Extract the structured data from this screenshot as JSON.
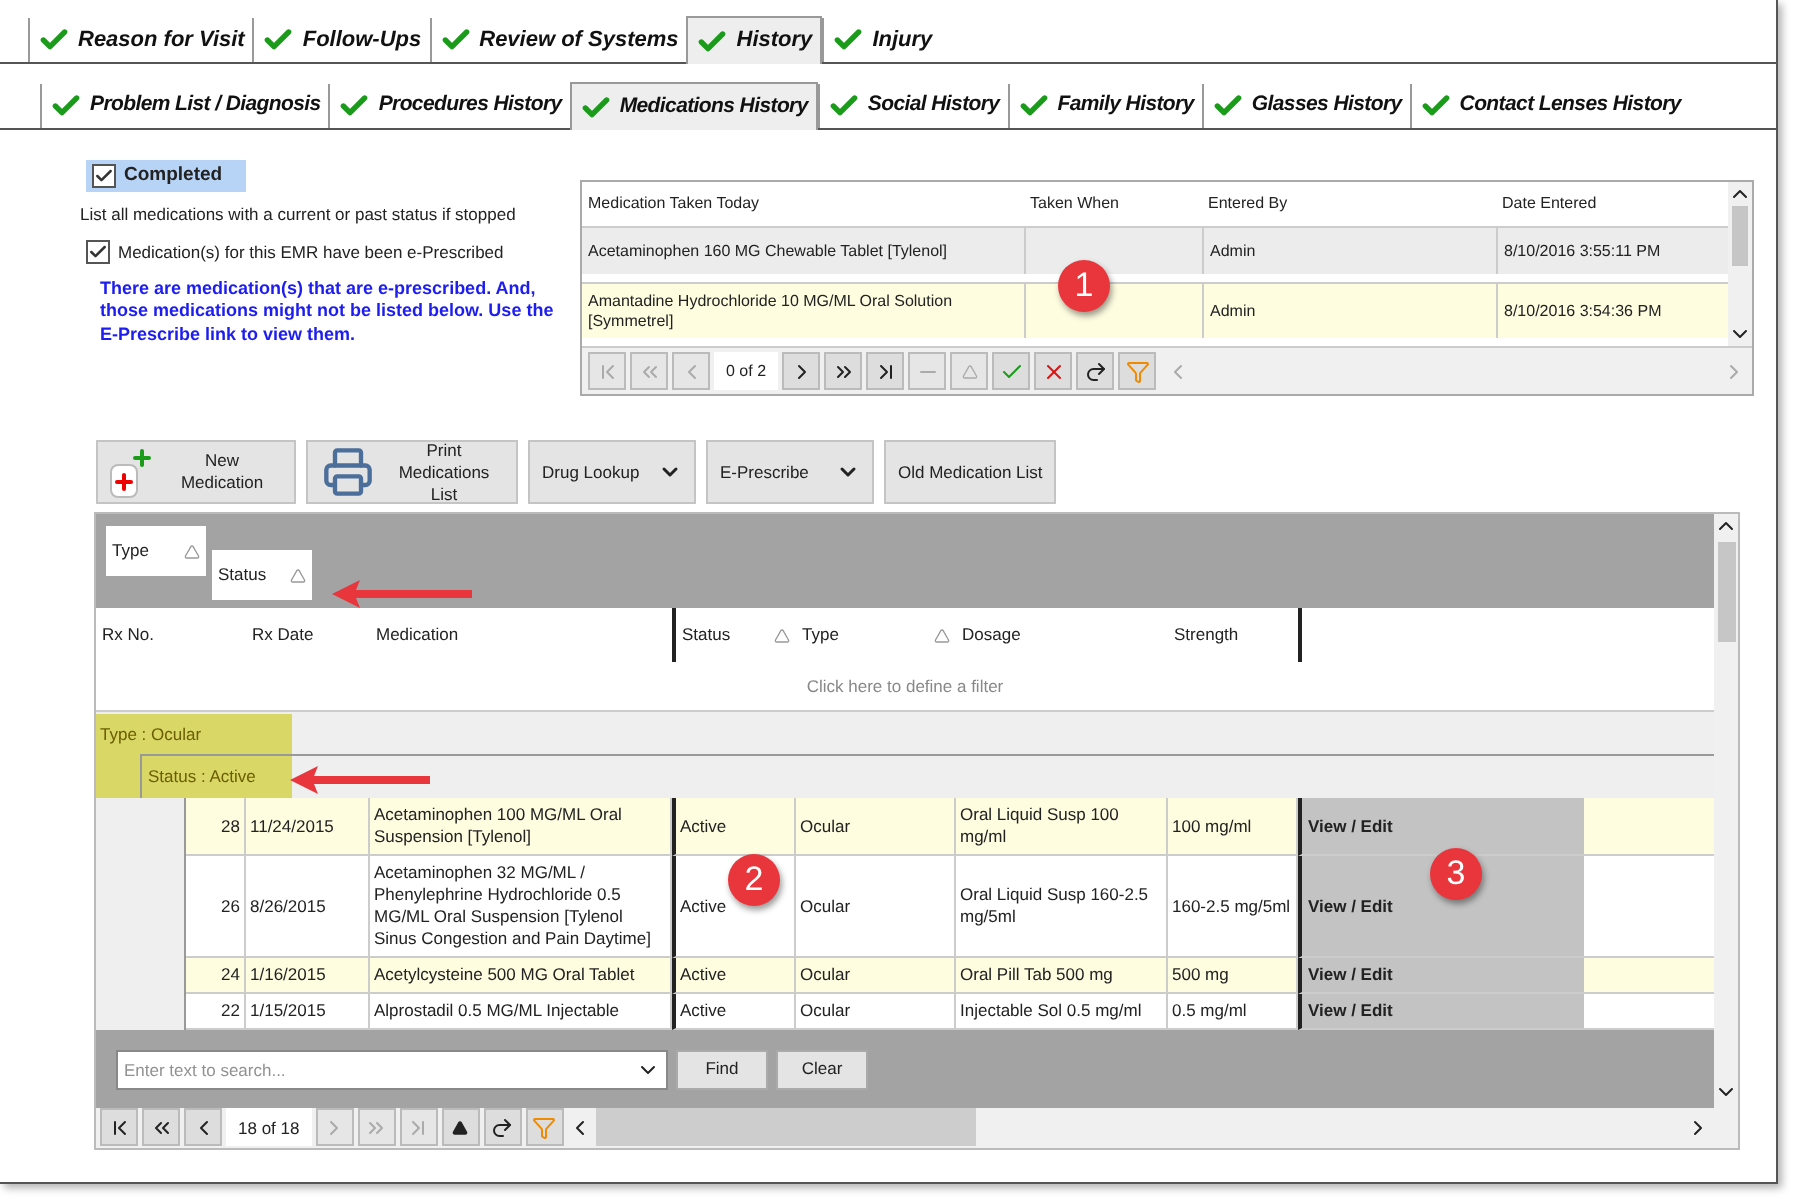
{
  "main_tabs": [
    {
      "label": "Reason for Visit",
      "selected": false
    },
    {
      "label": "Follow-Ups",
      "selected": false
    },
    {
      "label": "Review of Systems",
      "selected": false
    },
    {
      "label": "History",
      "selected": true
    },
    {
      "label": "Injury",
      "selected": false
    }
  ],
  "sub_tabs": [
    {
      "label": "Problem List / Diagnosis",
      "selected": false
    },
    {
      "label": "Procedures History",
      "selected": false
    },
    {
      "label": "Medications History",
      "selected": true
    },
    {
      "label": "Social History",
      "selected": false
    },
    {
      "label": "Family History",
      "selected": false
    },
    {
      "label": "Glasses History",
      "selected": false
    },
    {
      "label": "Contact Lenses History",
      "selected": false
    }
  ],
  "completed": {
    "label": "Completed",
    "checked": true
  },
  "note": "List all medications with a current or past status if stopped",
  "eprescribed": {
    "label": "Medication(s) for this EMR have been e-Prescribed",
    "checked": true
  },
  "warning": "There are medication(s) that are e-prescribed. And, those medications might not be listed below.  Use the E-Prescribe link to view them.",
  "today_grid": {
    "columns": [
      "Medication Taken Today",
      "Taken When",
      "Entered By",
      "Date Entered"
    ],
    "rows": [
      {
        "medication": "Acetaminophen 160 MG Chewable Tablet [Tylenol]",
        "entered_by": "Admin",
        "date_entered": "8/10/2016 3:55:11 PM",
        "selected": false
      },
      {
        "medication": "Amantadine Hydrochloride 10 MG/ML Oral Solution [Symmetrel]",
        "entered_by": "Admin",
        "date_entered": "8/10/2016 3:54:36 PM",
        "selected": true
      }
    ],
    "pager": "0 of 2"
  },
  "toolbar": [
    {
      "kind": "medicine",
      "label": "New Medication"
    },
    {
      "kind": "printer",
      "label": "Print Medications List"
    },
    {
      "kind": "dropdown",
      "label": "Drug Lookup"
    },
    {
      "kind": "dropdown",
      "label": "E-Prescribe"
    },
    {
      "kind": "plain",
      "label": "Old Medication List"
    }
  ],
  "group_panel": [
    "Type",
    "Status"
  ],
  "columns": [
    {
      "label": "Rx No.",
      "sortable": false
    },
    {
      "label": "Rx Date",
      "sortable": false
    },
    {
      "label": "Medication",
      "sortable": false
    },
    {
      "label": "Status",
      "sortable": true
    },
    {
      "label": "Type",
      "sortable": true
    },
    {
      "label": "Dosage",
      "sortable": false
    },
    {
      "label": "Strength",
      "sortable": false
    }
  ],
  "filter_hint": "Click here to define a filter",
  "group_type": "Type : Ocular",
  "group_status": "Status : Active",
  "rows": [
    {
      "rx_no": "28",
      "rx_date": "11/24/2015",
      "medication": "Acetaminophen 100 MG/ML Oral Suspension [Tylenol]",
      "status": "Active",
      "type": "Ocular",
      "dosage": "Oral Liquid Susp 100 mg/ml",
      "strength": "100 mg/ml",
      "action": "View / Edit"
    },
    {
      "rx_no": "26",
      "rx_date": "8/26/2015",
      "medication": "Acetaminophen 32 MG/ML / Phenylephrine Hydrochloride 0.5 MG/ML Oral Suspension [Tylenol Sinus Congestion and Pain Daytime]",
      "status": "Active",
      "type": "Ocular",
      "dosage": "Oral Liquid Susp 160-2.5 mg/5ml",
      "strength": "160-2.5 mg/5ml",
      "action": "View / Edit"
    },
    {
      "rx_no": "24",
      "rx_date": "1/16/2015",
      "medication": "Acetylcysteine 500 MG Oral Tablet",
      "status": "Active",
      "type": "Ocular",
      "dosage": "Oral Pill Tab 500 mg",
      "strength": "500 mg",
      "action": "View / Edit"
    },
    {
      "rx_no": "22",
      "rx_date": "1/15/2015",
      "medication": "Alprostadil 0.5 MG/ML Injectable",
      "status": "Active",
      "type": "Ocular",
      "dosage": "Injectable Sol 0.5 mg/ml",
      "strength": "0.5 mg/ml",
      "action": "View / Edit"
    }
  ],
  "search": {
    "placeholder": "Enter text to search...",
    "buttons": [
      "Find",
      "Clear"
    ]
  },
  "pager": "18 of 18",
  "callouts": [
    "1",
    "2",
    "3"
  ]
}
